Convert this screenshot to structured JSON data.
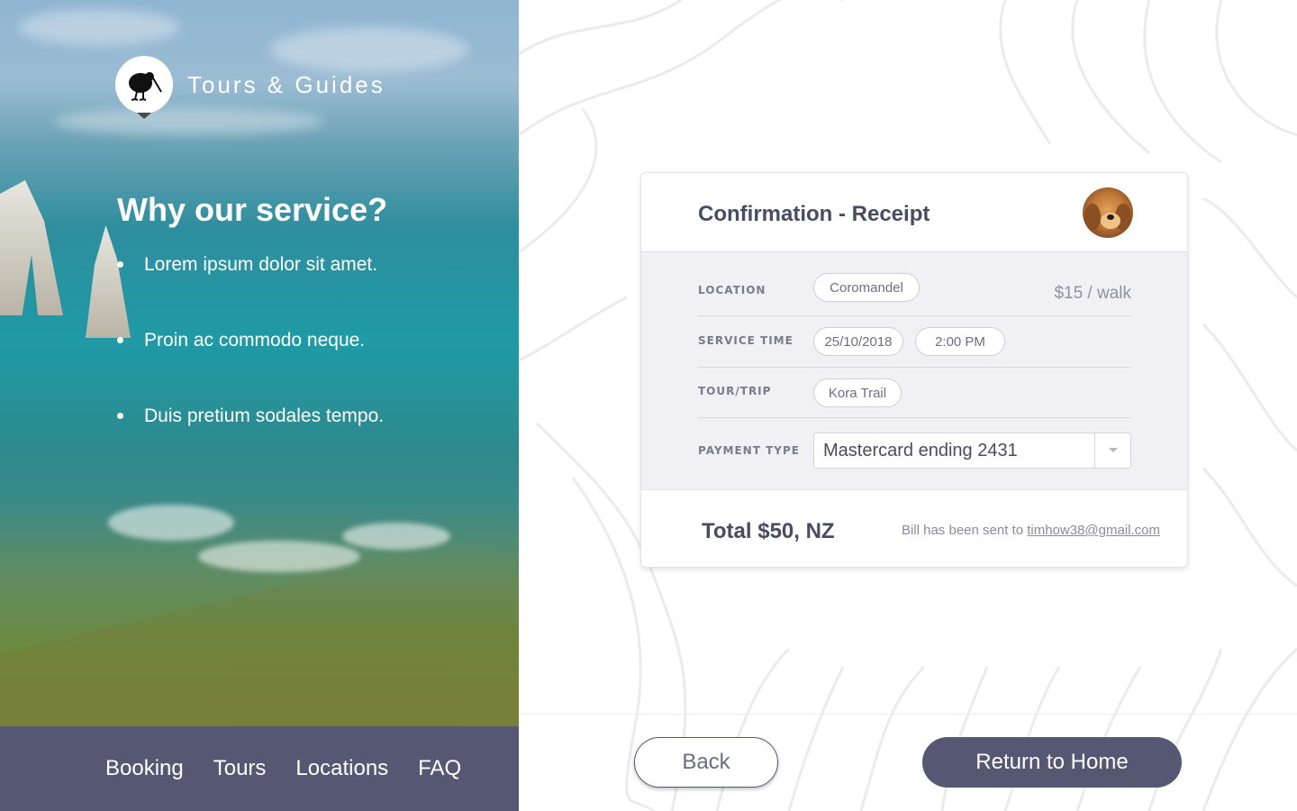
{
  "brand": {
    "name": "Tours & Guides",
    "logo_icon": "kiwi-bird-icon"
  },
  "why": {
    "title": "Why our service?",
    "items": [
      "Lorem ipsum dolor sit amet.",
      "Proin ac commodo neque.",
      "Duis pretium sodales tempo."
    ]
  },
  "nav": {
    "items": [
      "Booking",
      "Tours",
      "Locations",
      "FAQ"
    ]
  },
  "receipt": {
    "title": "Confirmation - Receipt",
    "avatar_icon": "dog-avatar",
    "location_label": "LOCATION",
    "location_value": "Coromandel",
    "price": "$15 / walk",
    "service_time_label": "SERVICE TIME",
    "service_date": "25/10/2018",
    "service_hour": "2:00 PM",
    "tour_label": "TOUR/TRIP",
    "tour_value": "Kora Trail",
    "payment_label": "PAYMENT TYPE",
    "payment_value": "Mastercard ending 2431",
    "total": "Total $50, NZ",
    "bill_text": "Bill has been sent to ",
    "bill_email": "timhow38@gmail.com"
  },
  "actions": {
    "back_label": "Back",
    "home_label": "Return to Home"
  },
  "colors": {
    "primary": "#565772",
    "card_body": "#f0f0f5",
    "text_dark": "#4a4b63"
  }
}
